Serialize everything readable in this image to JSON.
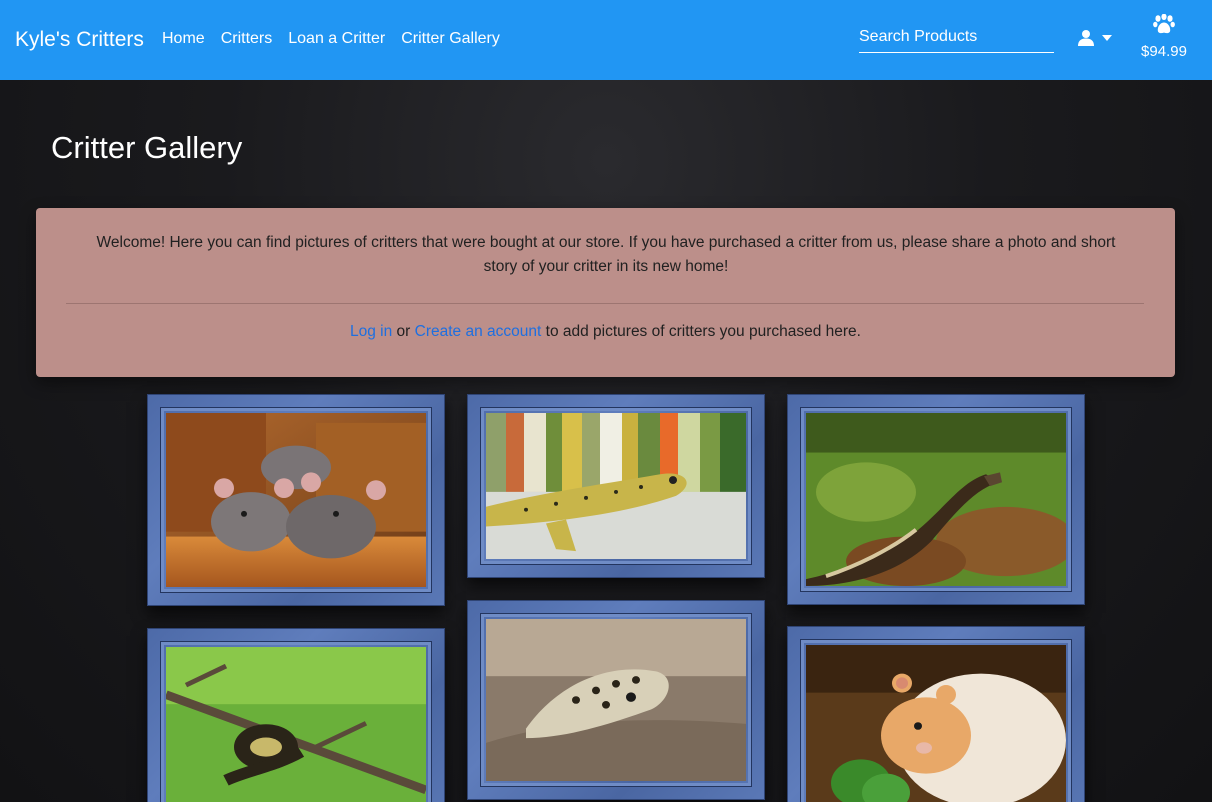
{
  "navbar": {
    "brand": "Kyle's Critters",
    "links": [
      "Home",
      "Critters",
      "Loan a Critter",
      "Critter Gallery"
    ],
    "search_placeholder": "Search Products",
    "user_icon": "user-icon",
    "cart_icon": "paw-icon",
    "cart_total": "$94.99",
    "color": "#2196f3"
  },
  "page": {
    "title": "Critter Gallery"
  },
  "welcome": {
    "message": "Welcome! Here you can find pictures of critters that were bought at our store. If you have purchased a critter from us, please share a photo and short story of your critter in its new home!",
    "login_link": "Log in",
    "or_text": " or ",
    "create_link": "Create an account",
    "suffix_text": " to add pictures of critters you purchased here."
  },
  "gallery": [
    {
      "subject": "rats"
    },
    {
      "subject": "leopard gecko"
    },
    {
      "subject": "ball python"
    },
    {
      "subject": "ball python on branch"
    },
    {
      "subject": "leopard gecko on wood"
    },
    {
      "subject": "hamster with broccoli"
    }
  ]
}
